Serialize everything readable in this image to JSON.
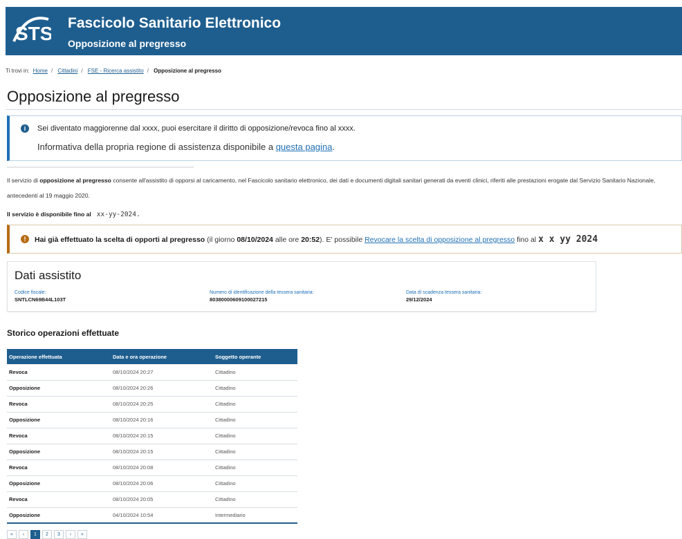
{
  "header": {
    "title": "Fascicolo Sanitario Elettronico",
    "subtitle": "Opposizione al pregresso",
    "logo_text": "STS"
  },
  "breadcrumb": {
    "prefix": "Ti trovi in:",
    "items": [
      "Home",
      "Cittadini",
      "FSE - Ricerca assistito"
    ],
    "current": "Opposizione al pregresso"
  },
  "page_title": "Opposizione al pregresso",
  "info_box": {
    "line1": "Sei diventato maggiorenne dal xxxx, puoi esercitare il diritto di opposizione/revoca fino al xxxx.",
    "line2_prefix": "Informativa della propria regione di assistenza disponibile a ",
    "line2_link": "questa pagina",
    "line2_suffix": "."
  },
  "description": {
    "prefix": "Il servizio di ",
    "bold": "opposizione al pregresso",
    "text": " consente all'assistito di opporsi al caricamento, nel Fascicolo sanitario elettronico, dei dati e documenti digitali sanitari generati da eventi clinici, riferiti alle prestazioni erogate dal Servizio Sanitario Nazionale, antecedenti al 19 maggio 2020."
  },
  "availability": {
    "label": "Il servizio è disponibile fino al",
    "date": "xx-yy-2024."
  },
  "warning": {
    "bold1": "Hai già effettuato la scelta di opporti al pregresso",
    "text1": " (il giorno ",
    "date_bold": "08/10/2024",
    "text2": " alle ore ",
    "time_bold": "20:52",
    "text3": "). E' possibile ",
    "link": "Revocare la scelta di opposizione al pregresso",
    "text4": " fino al ",
    "deadline": "x x yy 2024"
  },
  "dati_assistito": {
    "title": "Dati assistito",
    "fields": [
      {
        "label": "Codice fiscale:",
        "value": "SNTLCN69B44L103T"
      },
      {
        "label": "Numero di identificazione della tessera sanitaria:",
        "value": "80380000609100027215"
      },
      {
        "label": "Data di scadenza tessera sanitaria:",
        "value": "29/12/2024"
      }
    ]
  },
  "storico": {
    "title": "Storico operazioni effettuate",
    "columns": [
      "Operazione effettuata",
      "Data e ora operazione",
      "Soggetto operante"
    ],
    "rows": [
      [
        "Revoca",
        "08/10/2024 20:27",
        "Cittadino"
      ],
      [
        "Opposizione",
        "08/10/2024 20:26",
        "Cittadino"
      ],
      [
        "Revoca",
        "08/10/2024 20:25",
        "Cittadino"
      ],
      [
        "Opposizione",
        "08/10/2024 20:16",
        "Cittadino"
      ],
      [
        "Revoca",
        "08/10/2024 20:15",
        "Cittadino"
      ],
      [
        "Opposizione",
        "08/10/2024 20:15",
        "Cittadino"
      ],
      [
        "Revoca",
        "08/10/2024 20:08",
        "Cittadino"
      ],
      [
        "Opposizione",
        "08/10/2024 20:06",
        "Cittadino"
      ],
      [
        "Revoca",
        "08/10/2024 20:05",
        "Cittadino"
      ],
      [
        "Opposizione",
        "04/10/2024 10:54",
        "Intermediario"
      ]
    ]
  },
  "pagination": {
    "first": "«",
    "prev": "‹",
    "pages": [
      "1",
      "2",
      "3"
    ],
    "next": "›",
    "last": "»"
  },
  "colors": {
    "primary": "#1e5e8f",
    "warning_accent": "#b76c14",
    "info_accent": "#1e6fb5"
  }
}
